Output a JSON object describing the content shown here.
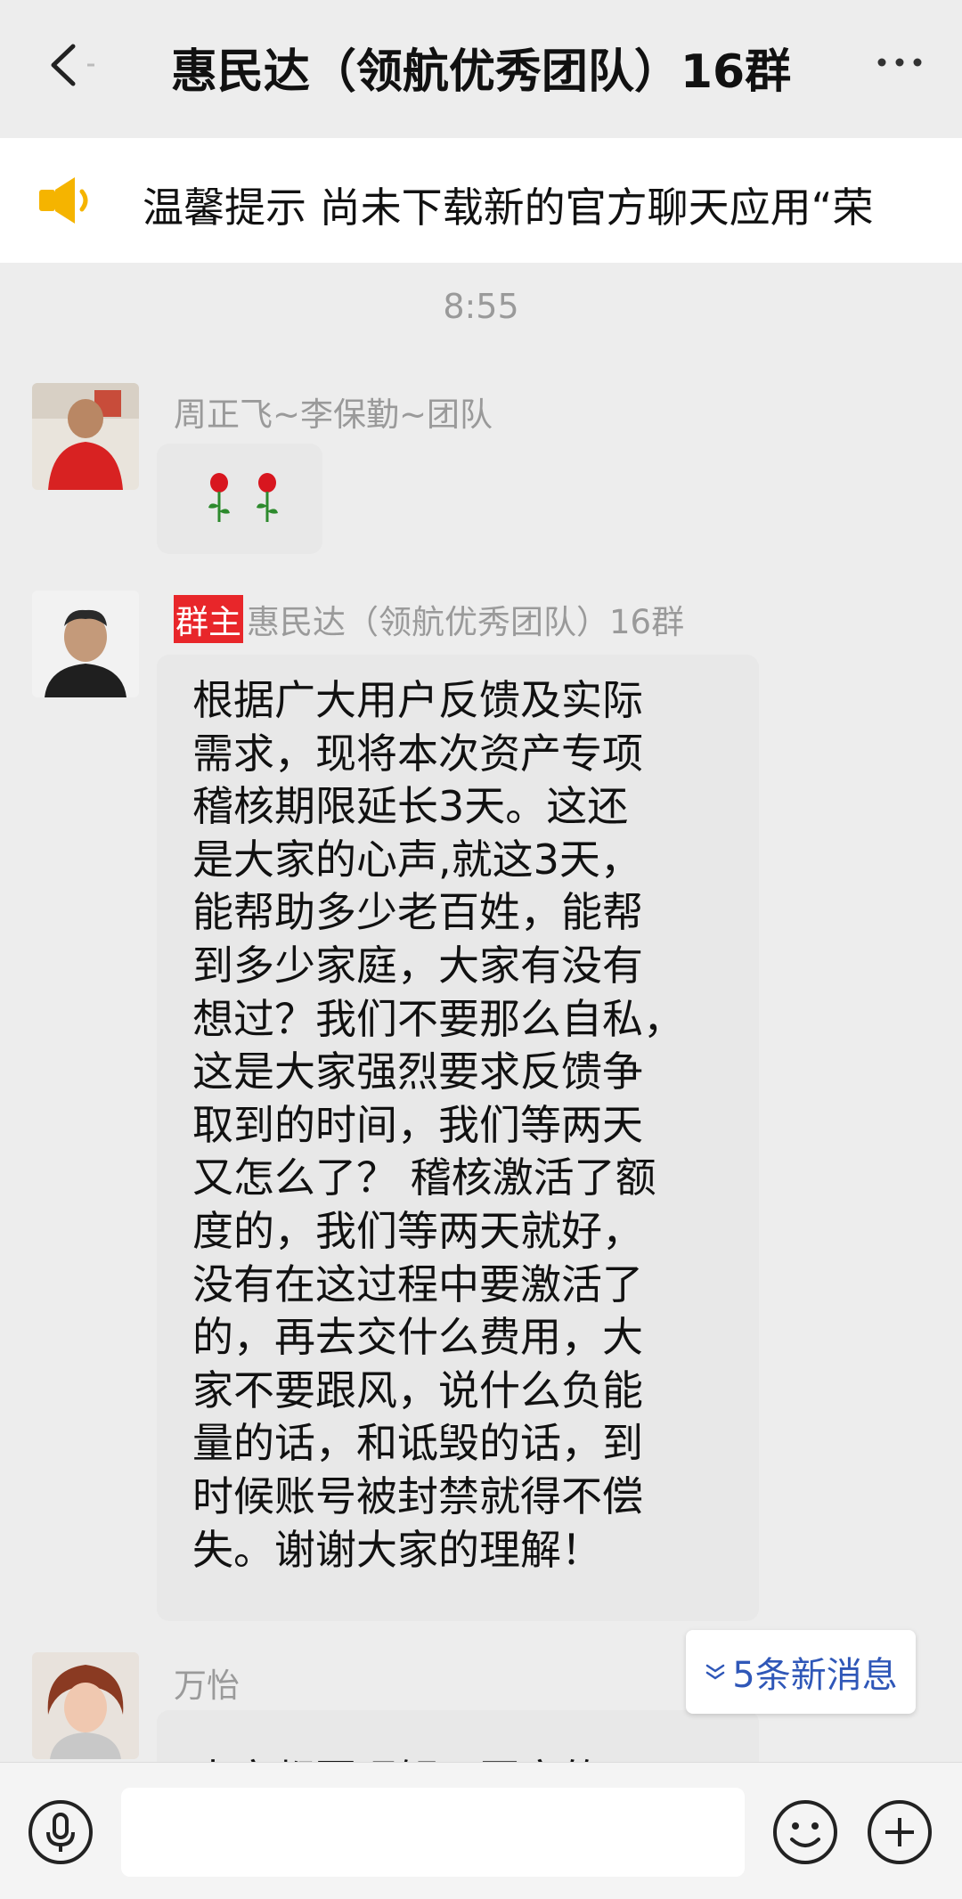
{
  "header": {
    "title": "惠民达（领航优秀团队）16群",
    "back_icon": "back-chevron-icon",
    "more_icon": "more-dots-icon"
  },
  "notice": {
    "icon": "speaker-icon",
    "text": "温馨提示 尚未下载新的官方聊天应用“荣"
  },
  "chat": {
    "timestamp": "8:55",
    "messages": [
      {
        "sender": "周正飞~李保勤~团队",
        "content_icons": [
          "rose-icon",
          "rose-icon"
        ]
      },
      {
        "badge": "群主",
        "sender": "惠民达（领航优秀团队）16群",
        "text": "根据广大用户反馈及实际\n需求，现将本次资产专项\n稽核期限延长3天。这还\n是大家的心声,就这3天，\n能帮助多少老百姓，能帮\n到多少家庭，大家有没有\n想过？我们不要那么自私，\n这是大家强烈要求反馈争\n取到的时间，我们等两天\n又怎么了？ 稽核激活了额\n度的，我们等两天就好，\n没有在这过程中要激活了\n的，再去交什么费用，大\n家不要跟风，说什么负能\n量的话，和诋毁的话，到\n时候账号被封禁就得不偿\n失。谢谢大家的理解！"
      },
      {
        "sender": "万怡",
        "text": "大家都要理解，国家的目"
      }
    ]
  },
  "new_messages": {
    "label": "5条新消息",
    "icon": "double-chevron-down-icon"
  },
  "input_bar": {
    "voice_icon": "voice-icon",
    "emoji_icon": "emoji-icon",
    "plus_icon": "plus-icon",
    "placeholder": ""
  },
  "colors": {
    "background": "#ededed",
    "owner_badge": "#e8262a",
    "link_blue": "#2f57b8",
    "speaker_yellow": "#f5b400"
  }
}
